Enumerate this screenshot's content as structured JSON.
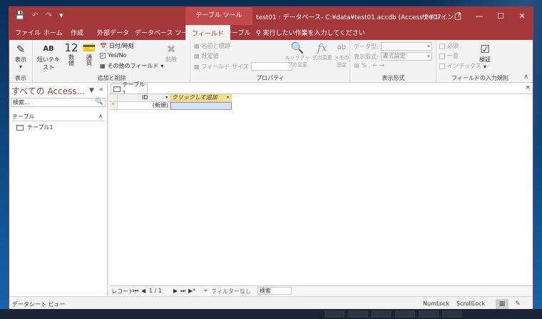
{
  "window": {
    "title": "test01 : データベース- C:¥data¥test01.accdb (Access 2007…",
    "contextual_tab_group": "テーブル ツール",
    "sign_in": "サインイン",
    "help": "?"
  },
  "tabs": [
    {
      "label": "ファイル"
    },
    {
      "label": "ホーム"
    },
    {
      "label": "作成"
    },
    {
      "label": "外部データ"
    },
    {
      "label": "データベース ツール"
    },
    {
      "label": "フィールド"
    },
    {
      "label": "テーブル"
    }
  ],
  "active_tab": "フィールド",
  "tell_me": "実行したい作業を入力してください",
  "ribbon": {
    "views": {
      "label": "表示",
      "button": "表示"
    },
    "add_delete": {
      "label": "追加と削除",
      "short_text": "短いテキスト",
      "short_text_icon": "AB",
      "number": "数値",
      "number_icon": "12",
      "currency": "通貨",
      "datetime": "日付/時刻",
      "yesno": "Yes/No",
      "more_fields": "その他のフィールド",
      "delete": "削除"
    },
    "properties": {
      "label": "プロパティ",
      "name_caption": "名前と標題",
      "default_value": "既定値",
      "field_size": "フィールド サイズ",
      "lookup_change": "ルックアップの変更",
      "expression_change": "式の変更",
      "memo_settings": "メモの設定"
    },
    "formatting": {
      "label": "表示形式",
      "data_type": "データ型:",
      "format": "表示形式:",
      "format_value": "書式設定"
    },
    "validation": {
      "label": "フィールドの入力規則",
      "required": "必須",
      "unique": "一意",
      "indexed": "インデックス",
      "validate": "検証"
    }
  },
  "nav_pane": {
    "title": "すべての Access...",
    "search_placeholder": "検索...",
    "group": "テーブル",
    "items": [
      {
        "label": "テーブル1"
      }
    ]
  },
  "document": {
    "tab_label": "テーブル1",
    "columns": [
      "ID",
      "クリックして追加"
    ],
    "new_row_marker": "*",
    "new_row_value": "(新規)"
  },
  "record_nav": {
    "label": "レコード:",
    "position": "1 / 1",
    "filter": "フィルターなし",
    "search": "検索"
  },
  "status": {
    "view": "データシート ビュー",
    "numlock": "NumLock",
    "scrolllock": "ScrollLock"
  }
}
